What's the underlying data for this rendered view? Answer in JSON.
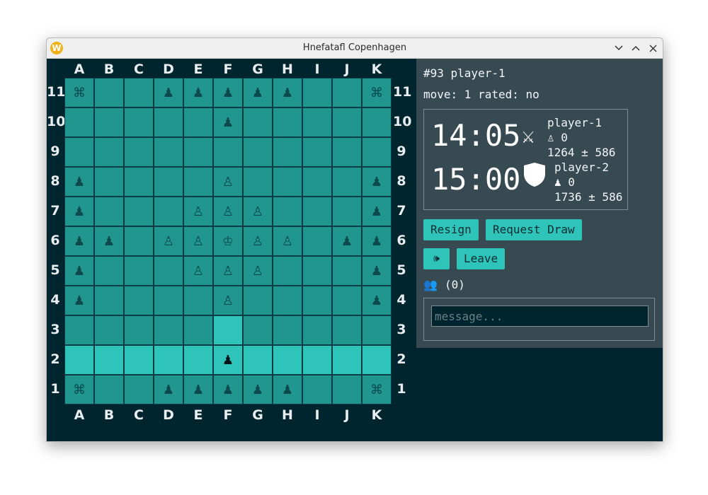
{
  "window": {
    "title": "Hnefatafl Copenhagen",
    "app_icon": "W"
  },
  "board": {
    "columns": [
      "A",
      "B",
      "C",
      "D",
      "E",
      "F",
      "G",
      "H",
      "I",
      "J",
      "K"
    ],
    "rows": [
      "11",
      "10",
      "9",
      "8",
      "7",
      "6",
      "5",
      "4",
      "3",
      "2",
      "1"
    ],
    "grid": [
      [
        "⌘",
        "",
        "",
        "♟",
        "♟",
        "♟",
        "♟",
        "♟",
        "",
        "",
        "⌘"
      ],
      [
        "",
        "",
        "",
        "",
        "",
        "♟",
        "",
        "",
        "",
        "",
        ""
      ],
      [
        "",
        "",
        "",
        "",
        "",
        "",
        "",
        "",
        "",
        "",
        ""
      ],
      [
        "♟",
        "",
        "",
        "",
        "",
        "♙",
        "",
        "",
        "",
        "",
        "♟"
      ],
      [
        "♟",
        "",
        "",
        "",
        "♙",
        "♙",
        "♙",
        "",
        "",
        "",
        "♟"
      ],
      [
        "♟",
        "♟",
        "",
        "♙",
        "♙",
        "♔",
        "♙",
        "♙",
        "",
        "♟",
        "♟"
      ],
      [
        "♟",
        "",
        "",
        "",
        "♙",
        "♙",
        "♙",
        "",
        "",
        "",
        "♟"
      ],
      [
        "♟",
        "",
        "",
        "",
        "",
        "♙",
        "",
        "",
        "",
        "",
        "♟"
      ],
      [
        "",
        "",
        "",
        "",
        "",
        "",
        "",
        "",
        "",
        "",
        ""
      ],
      [
        "",
        "",
        "",
        "",
        "",
        "♟",
        "",
        "",
        "",
        "",
        ""
      ],
      [
        "⌘",
        "",
        "",
        "♟",
        "♟",
        "♟",
        "♟",
        "♟",
        "",
        "",
        "⌘"
      ]
    ],
    "highlights": [
      "F3",
      "A2",
      "B2",
      "C2",
      "D2",
      "E2",
      "G2",
      "H2",
      "I2",
      "J2",
      "K2"
    ],
    "selected": "F2"
  },
  "panel": {
    "game_label": "#93 player-1",
    "status": "move: 1 rated: no",
    "players": [
      {
        "clock": "14:05",
        "role_icon": "crossed-swords-icon",
        "role_glyph": "⚔",
        "name": "player-1",
        "captured": "♙ 0",
        "rating": "1264 ± 586"
      },
      {
        "clock": "15:00",
        "role_icon": "shield-icon",
        "role_glyph": "",
        "name": "player-2",
        "captured": "♟ 0",
        "rating": "1736 ± 586"
      }
    ],
    "resign_label": "Resign",
    "request_draw_label": "Request Draw",
    "sound_glyph": "🕪",
    "leave_label": "Leave",
    "users_glyph": "👥",
    "users_count": "(0)",
    "message_placeholder": "message..."
  }
}
